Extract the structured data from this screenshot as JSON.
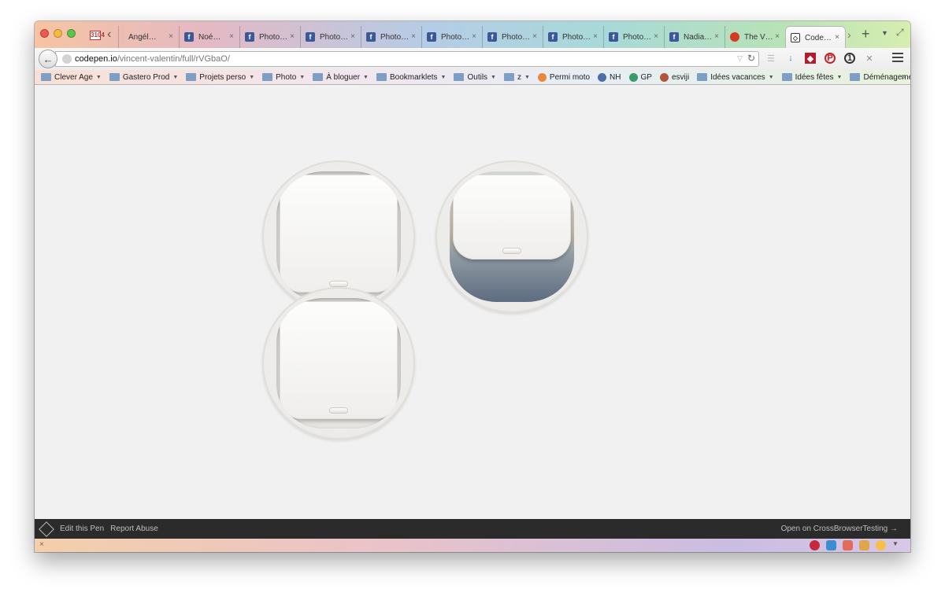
{
  "browser": {
    "pinned_tab_badge": "3104",
    "tabs": [
      {
        "label": "Angél…",
        "icon": "plain"
      },
      {
        "label": "Noé…",
        "icon": "facebook"
      },
      {
        "label": "Photo…",
        "icon": "facebook"
      },
      {
        "label": "Photo…",
        "icon": "facebook"
      },
      {
        "label": "Photo…",
        "icon": "facebook"
      },
      {
        "label": "Photo…",
        "icon": "facebook"
      },
      {
        "label": "Photo…",
        "icon": "facebook"
      },
      {
        "label": "Photo…",
        "icon": "facebook"
      },
      {
        "label": "Photo…",
        "icon": "facebook"
      },
      {
        "label": "Nadia…",
        "icon": "facebook"
      },
      {
        "label": "The V…",
        "icon": "verge"
      },
      {
        "label": "Code…",
        "icon": "codepen",
        "active": true
      }
    ],
    "close_glyph": "×",
    "url": {
      "host": "codepen.io",
      "path": "/vincent-valentin/full/rVGbaO/"
    },
    "bookmarks": [
      {
        "label": "Clever Age",
        "type": "folder"
      },
      {
        "label": "Gastero Prod",
        "type": "folder"
      },
      {
        "label": "Projets perso",
        "type": "folder"
      },
      {
        "label": "Photo",
        "type": "folder"
      },
      {
        "label": "À bloguer",
        "type": "folder"
      },
      {
        "label": "Bookmarklets",
        "type": "folder"
      },
      {
        "label": "Outils",
        "type": "folder"
      },
      {
        "label": "z",
        "type": "folder"
      },
      {
        "label": "Permi moto",
        "type": "link"
      },
      {
        "label": "NH",
        "type": "link"
      },
      {
        "label": "GP",
        "type": "link"
      },
      {
        "label": "esviji",
        "type": "link"
      },
      {
        "label": "Idées vacances",
        "type": "folder"
      },
      {
        "label": "Idées fêtes",
        "type": "folder"
      },
      {
        "label": "Déménagement",
        "type": "folder"
      }
    ],
    "bookmarks_more": "»"
  },
  "pen": {
    "portholes": [
      {
        "state": "closed"
      },
      {
        "state": "half-open"
      },
      {
        "state": "closed"
      }
    ]
  },
  "codepen_bar": {
    "edit_label": "Edit this Pen",
    "report_label": "Report Abuse",
    "cbt_label": "Open on CrossBrowserTesting →"
  },
  "addon_bar": {
    "close_glyph": "×"
  },
  "colors": {
    "facebook": "#3b5998",
    "codepen_bar": "#2b2b2b",
    "sky_top": "#d3d6d4",
    "sky_bottom": "#5d6c80"
  }
}
